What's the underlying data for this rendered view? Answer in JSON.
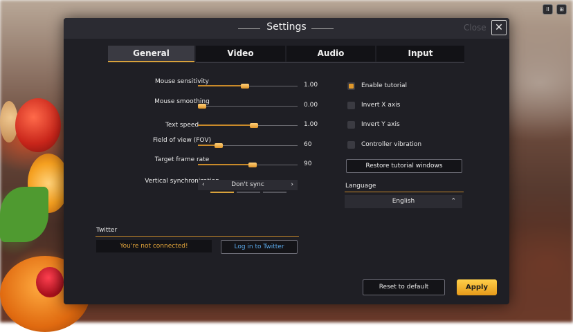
{
  "window": {
    "title": "Settings",
    "close_label": "Close",
    "close_glyph": "✕"
  },
  "hud": {
    "pause_glyph": "II",
    "grid_glyph": "⊞"
  },
  "tabs": [
    {
      "label": "General",
      "active": true
    },
    {
      "label": "Video",
      "active": false
    },
    {
      "label": "Audio",
      "active": false
    },
    {
      "label": "Input",
      "active": false
    }
  ],
  "sliders": [
    {
      "label": "Mouse sensitivity",
      "value": "1.00",
      "fraction": 0.47
    },
    {
      "label": "Mouse smoothing",
      "value": "0.00",
      "fraction": 0.0
    },
    {
      "label": "Text speed",
      "value": "1.00",
      "fraction": 0.57
    },
    {
      "label": "Field of view (FOV)",
      "value": "60",
      "fraction": 0.18
    },
    {
      "label": "Target frame rate",
      "value": "90",
      "fraction": 0.55
    }
  ],
  "vsync": {
    "label": "Vertical synchronization",
    "value": "Don't sync",
    "prev_glyph": "‹",
    "next_glyph": "›"
  },
  "toggles": [
    {
      "label": "Enable tutorial",
      "checked": true
    },
    {
      "label": "Invert X axis",
      "checked": false
    },
    {
      "label": "Invert Y axis",
      "checked": false
    },
    {
      "label": "Controller vibration",
      "checked": false
    }
  ],
  "restore_button": "Restore tutorial windows",
  "language": {
    "heading": "Language",
    "value": "English",
    "arrow_glyph": "⌃"
  },
  "twitter": {
    "heading": "Twitter",
    "status": "You're not connected!",
    "login_label": "Log in to Twitter"
  },
  "footer": {
    "reset_label": "Reset to default",
    "apply_label": "Apply"
  },
  "colors": {
    "accent": "#d8a23c",
    "link": "#5aa8e8",
    "panel": "#1f1f25"
  }
}
